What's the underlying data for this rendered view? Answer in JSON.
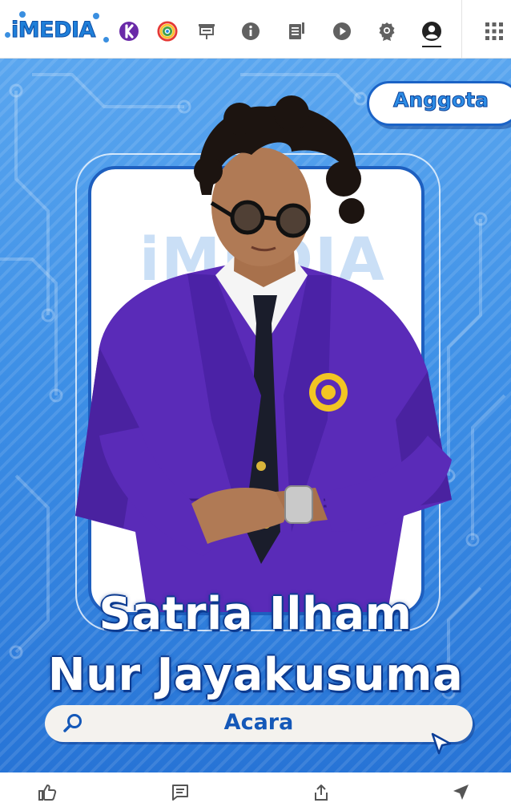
{
  "brand": {
    "name": "iMEDIA"
  },
  "nav": {
    "items": [
      {
        "icon": "purple-k-logo-icon"
      },
      {
        "icon": "colorful-spiral-logo-icon"
      },
      {
        "icon": "presentation-board-icon"
      },
      {
        "icon": "info-icon"
      },
      {
        "icon": "document-icon"
      },
      {
        "icon": "play-icon"
      },
      {
        "icon": "award-badge-icon"
      },
      {
        "icon": "profile-icon",
        "active": true
      }
    ],
    "apps_icon": "apps-grid-icon"
  },
  "hero": {
    "badge": "Anggota",
    "name_line1": "Satria Ilham",
    "name_line2": "Nur Jayakusuma",
    "ghost_logo": "iMEDIA",
    "search_label": "Acara",
    "colors": {
      "bg_top": "#5aa6ef",
      "bg_bottom": "#2774d6",
      "frame": "#1e5fbf",
      "jacket": "#5a2bb8"
    }
  },
  "actions": [
    {
      "icon": "thumbs-up-icon"
    },
    {
      "icon": "comment-icon"
    },
    {
      "icon": "share-icon"
    },
    {
      "icon": "send-icon"
    }
  ]
}
